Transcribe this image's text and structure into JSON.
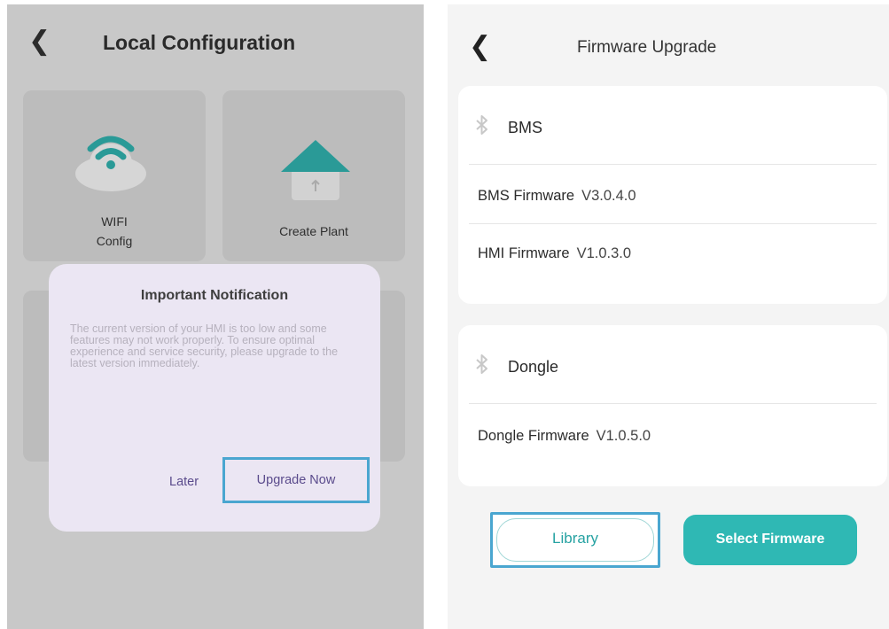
{
  "left": {
    "title": "Local Configuration",
    "tiles": {
      "wifi_label_line1": "WIFI",
      "wifi_label_line2": "Config",
      "plant_label": "Create Plant"
    },
    "dialog": {
      "title": "Important Notification",
      "body": "The current version of your HMI is too low and some features may not work properly. To ensure optimal experience and service security, please upgrade to the latest version immediately.",
      "later_label": "Later",
      "upgrade_label": "Upgrade Now"
    }
  },
  "right": {
    "title": "Firmware Upgrade",
    "bms_card": {
      "header": "BMS",
      "rows": [
        {
          "label": "BMS Firmware",
          "version": "V3.0.4.0"
        },
        {
          "label": "HMI Firmware",
          "version": "V1.0.3.0"
        }
      ]
    },
    "dongle_card": {
      "header": "Dongle",
      "rows": [
        {
          "label": "Dongle Firmware",
          "version": "V1.0.5.0"
        }
      ]
    },
    "library_label": "Library",
    "select_label": "Select Firmware"
  },
  "icons": {
    "back": "chevron-left-icon",
    "wifi": "wifi-cloud-icon",
    "plant": "house-icon",
    "bluetooth": "bluetooth-icon"
  },
  "colors": {
    "accent_teal": "#2fb8b4",
    "highlight_box": "#4aa6d0",
    "dialog_bg": "#ebe6f3",
    "dialog_action": "#5a4b8c"
  }
}
